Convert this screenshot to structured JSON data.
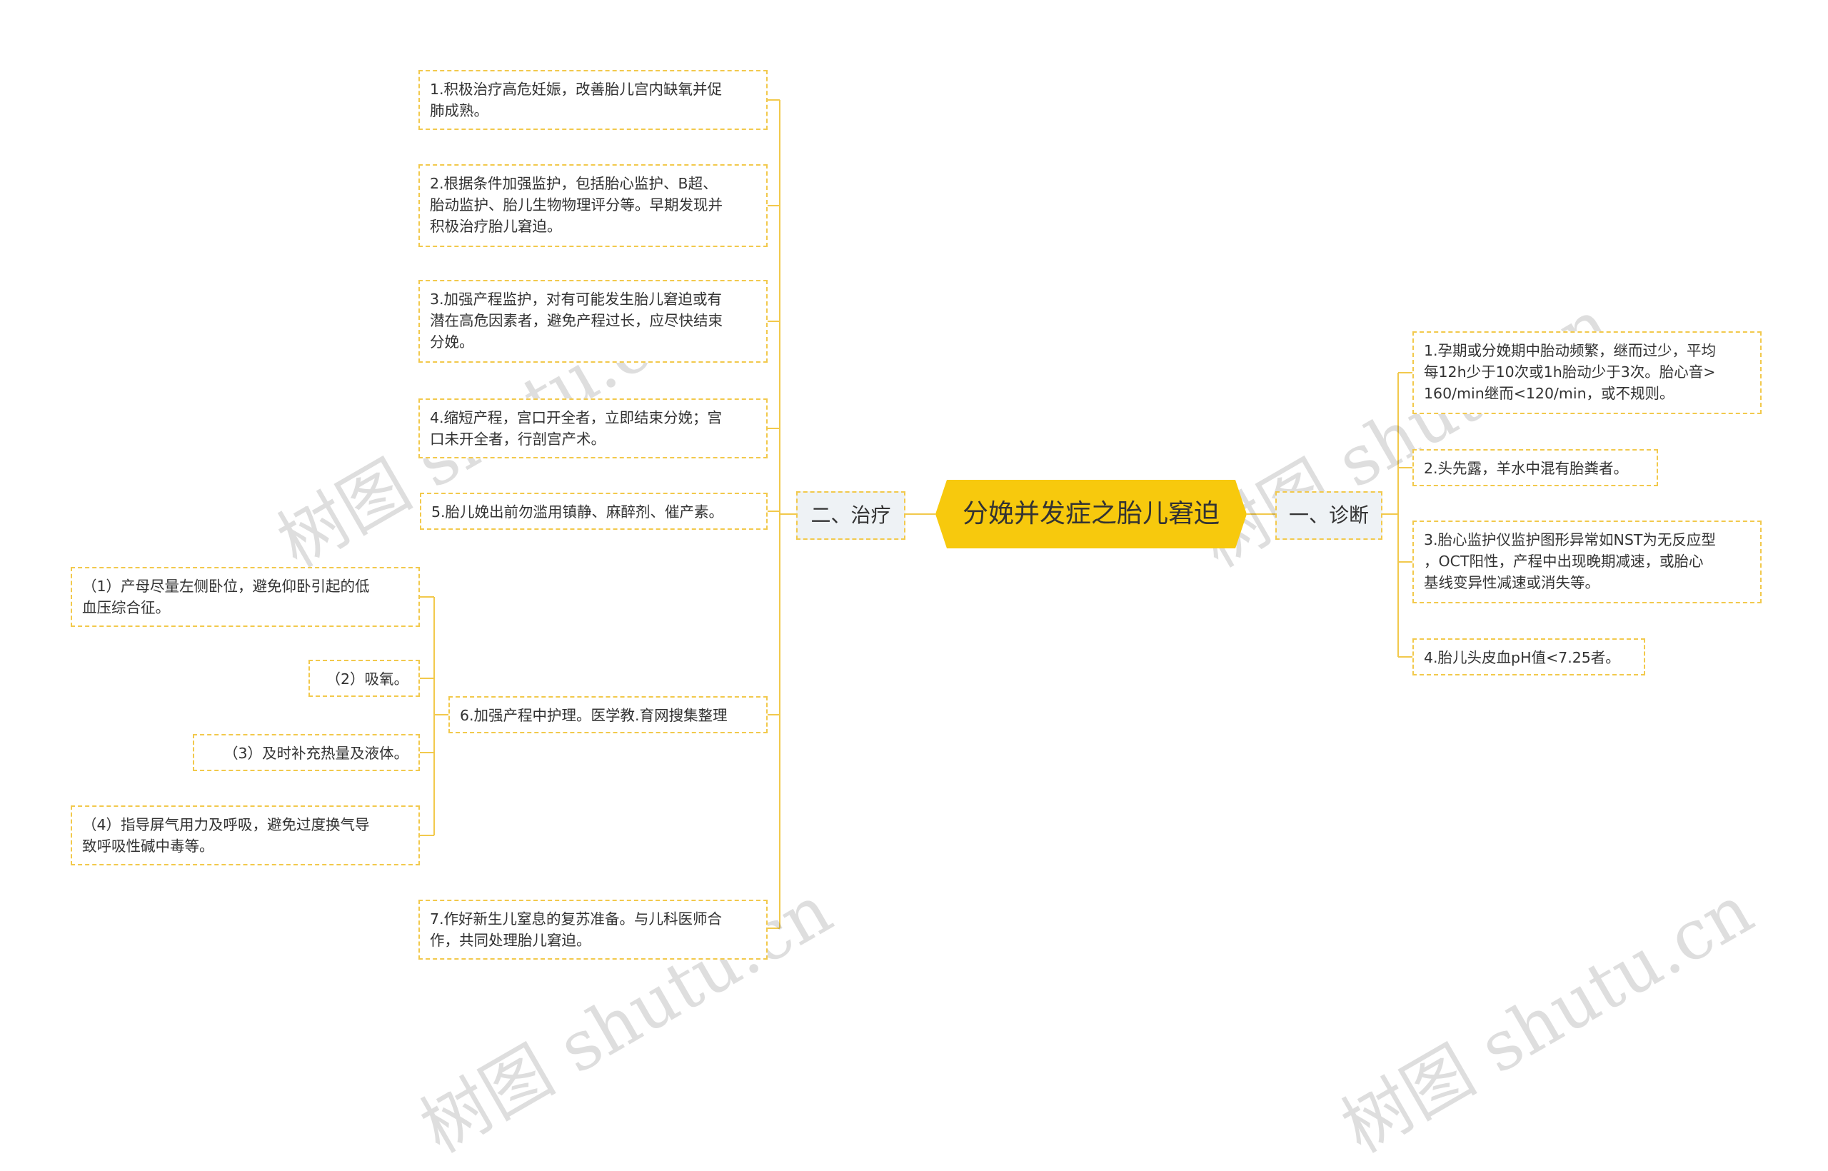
{
  "root": {
    "label": "分娩并发症之胎儿窘迫"
  },
  "branches": {
    "treatment": {
      "label": "二、治疗",
      "items": [
        {
          "text": "1.积极治疗高危妊娠，改善胎儿宫内缺氧并促\n肺成熟。"
        },
        {
          "text": "2.根据条件加强监护，包括胎心监护、B超、\n胎动监护、胎儿生物物理评分等。早期发现并\n积极治疗胎儿窘迫。"
        },
        {
          "text": "3.加强产程监护，对有可能发生胎儿窘迫或有\n潜在高危因素者，避免产程过长，应尽快结束\n分娩。"
        },
        {
          "text": "4.缩短产程，宫口开全者，立即结束分娩；宫\n口未开全者，行剖宫产术。"
        },
        {
          "text": "5.胎儿娩出前勿滥用镇静、麻醉剂、催产素。"
        },
        {
          "text": "6.加强产程中护理。医学教.育网搜集整理",
          "children": [
            {
              "text": "（1）产母尽量左侧卧位，避免仰卧引起的低\n血压综合征。"
            },
            {
              "text": "（2）吸氧。"
            },
            {
              "text": "（3）及时补充热量及液体。"
            },
            {
              "text": "（4）指导屏气用力及呼吸，避免过度换气导\n致呼吸性碱中毒等。"
            }
          ]
        },
        {
          "text": "7.作好新生儿窒息的复苏准备。与儿科医师合\n作，共同处理胎儿窘迫。"
        }
      ]
    },
    "diagnosis": {
      "label": "一、诊断",
      "items": [
        {
          "text": "1.孕期或分娩期中胎动频繁，继而过少，平均\n每12h少于10次或1h胎动少于3次。胎心音>\n160/min继而<120/min，或不规则。"
        },
        {
          "text": "2.头先露，羊水中混有胎粪者。"
        },
        {
          "text": "3.胎心监护仪监护图形异常如NST为无反应型\n，OCT阳性，产程中出现晚期减速，或胎心\n基线变异性减速或消失等。"
        },
        {
          "text": "4.胎儿头皮血pH值<7.25者。"
        }
      ]
    }
  },
  "watermark": "树图 shutu.cn",
  "colors": {
    "root_fill": "#f7c90d",
    "border": "#f2c94c",
    "branch_fill": "#eef2f5",
    "line": "#f2c94c"
  }
}
